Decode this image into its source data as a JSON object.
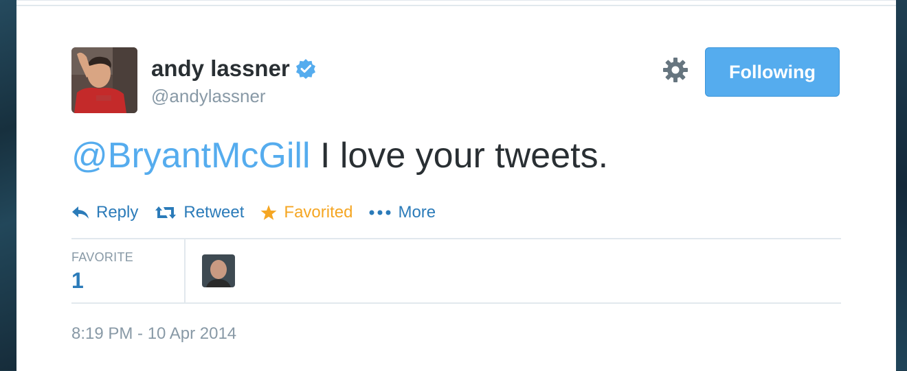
{
  "tweet": {
    "user": {
      "name": "andy lassner",
      "handle": "@andylassner",
      "verified": true
    },
    "follow_button_label": "Following",
    "text_mention": "@BryantMcGill",
    "text_body": " I love your tweets.",
    "actions": {
      "reply": "Reply",
      "retweet": "Retweet",
      "favorite": "Favorited",
      "more": "More"
    },
    "stats": {
      "label": "FAVORITE",
      "count": "1"
    },
    "timestamp": "8:19 PM - 10 Apr 2014"
  },
  "colors": {
    "link": "#2b7bb9",
    "mention": "#55acee",
    "favorited": "#f5a623",
    "button": "#55acee",
    "muted": "#8899a6",
    "text": "#292f33"
  },
  "icons": [
    "verified-badge-icon",
    "gear-icon",
    "reply-icon",
    "retweet-icon",
    "star-icon",
    "more-dots-icon"
  ]
}
